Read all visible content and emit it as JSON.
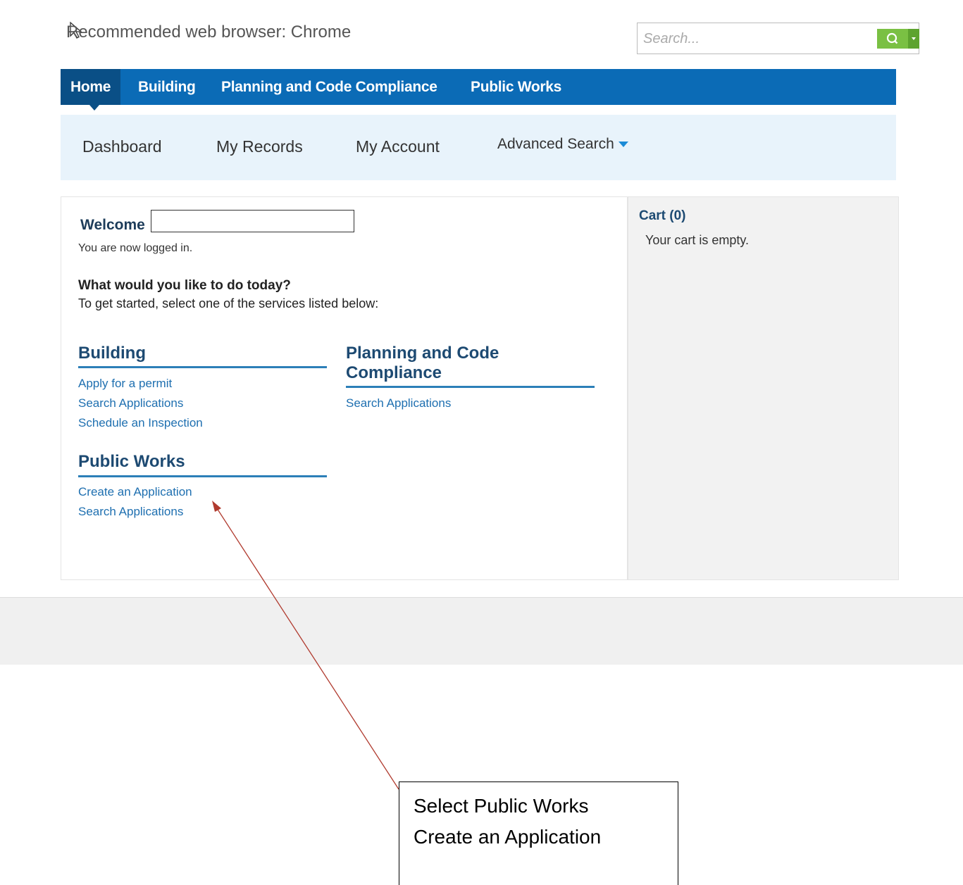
{
  "header": {
    "recommended_browser": "Recommended web browser: Chrome",
    "search_placeholder": "Search..."
  },
  "main_nav": {
    "tabs": [
      {
        "label": "Home",
        "active": true
      },
      {
        "label": "Building"
      },
      {
        "label": "Planning and Code Compliance"
      },
      {
        "label": "Public Works"
      }
    ]
  },
  "sub_nav": {
    "items": [
      {
        "label": "Dashboard"
      },
      {
        "label": "My Records"
      },
      {
        "label": "My Account"
      },
      {
        "label": "Advanced Search"
      }
    ]
  },
  "welcome": {
    "greeting": "Welcome",
    "status": "You are now logged in.",
    "question": "What would you like to do today?",
    "instruction": "To get started, select one of the services listed below:"
  },
  "services": {
    "building": {
      "title": "Building",
      "links": [
        "Apply for a permit",
        "Search Applications",
        "Schedule an Inspection"
      ]
    },
    "planning": {
      "title_line1": "Planning and Code",
      "title_line2": "Compliance",
      "links": [
        "Search Applications"
      ]
    },
    "public_works": {
      "title": "Public Works",
      "links": [
        "Create an Application",
        "Search Applications"
      ]
    }
  },
  "cart": {
    "title": "Cart (0)",
    "empty_message": "Your cart is empty."
  },
  "annotation": {
    "line1": "Select Public Works",
    "line2": "Create an Application"
  },
  "colors": {
    "nav_blue": "#0b6bb6",
    "nav_active": "#0a4f86",
    "subnav_bg": "#e8f3fb",
    "search_green": "#7ac043",
    "link_blue": "#1e6fb0",
    "annotation_arrow": "#b03a2e"
  },
  "icons": {
    "cursor": "mouse-pointer-icon",
    "search": "search-icon",
    "search_caret": "chevron-down-icon",
    "advanced_caret": "chevron-down-icon"
  }
}
